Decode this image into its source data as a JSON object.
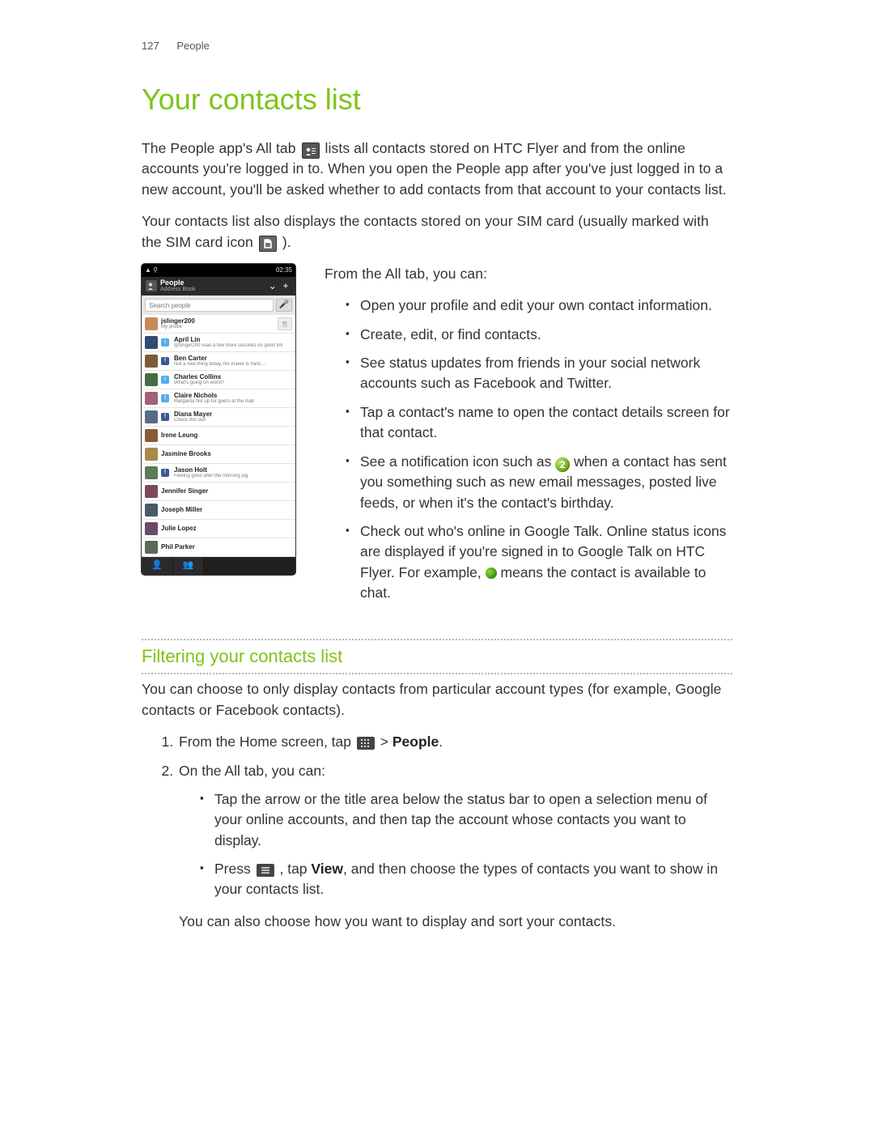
{
  "header": {
    "page_number": "127",
    "section": "People"
  },
  "title": "Your contacts list",
  "intro": {
    "p1a": "The People app's All tab ",
    "p1b": " lists all contacts stored on HTC Flyer and from the online accounts you're logged in to. When you open the People app after you've just logged in to a new account, you'll be asked whether to add contacts from that account to your contacts list.",
    "p2a": "Your contacts list also displays the contacts stored on your SIM card (usually marked with the SIM card icon ",
    "p2b": ")."
  },
  "phone": {
    "status_left": "▲ ⚲",
    "status_right": "02:35",
    "title": "People",
    "subtitle": "Address Book",
    "search_placeholder": "Search people",
    "contacts": [
      {
        "name": "jslinger200",
        "sub": "My profile",
        "color": "#c98b55",
        "right_btn": true
      },
      {
        "name": "April Lin",
        "sub": "@singer200 read a few more seconds on good tim",
        "color": "#324b72",
        "net": "tw"
      },
      {
        "name": "Ben Carter",
        "sub": "Not a new thing today, his maker is hard....",
        "color": "#7a5c3a",
        "net": "fb"
      },
      {
        "name": "Charles Collins",
        "sub": "What's going on world?",
        "color": "#4a6a45",
        "net": "tw"
      },
      {
        "name": "Claire Nichols",
        "sub": "Margarita fills up for goers at the mall",
        "color": "#a16278",
        "net": "tw"
      },
      {
        "name": "Diana Mayer",
        "sub": "Check this out!",
        "color": "#576b84",
        "net": "fb"
      },
      {
        "name": "Irene Leung",
        "sub": "",
        "color": "#8a5a3d"
      },
      {
        "name": "Jasmine Brooks",
        "sub": "",
        "color": "#a58a4a"
      },
      {
        "name": "Jason Holt",
        "sub": "Feeling good after the morning jog",
        "color": "#5c7a5c",
        "net": "fb"
      },
      {
        "name": "Jennifer Singer",
        "sub": "",
        "color": "#7a4a5a"
      },
      {
        "name": "Joseph Miller",
        "sub": "",
        "color": "#4a5a6a"
      },
      {
        "name": "Julie Lopez",
        "sub": "",
        "color": "#6a4a6a"
      },
      {
        "name": "Phil Parker",
        "sub": "",
        "color": "#5a6a5a"
      }
    ]
  },
  "all_tab": {
    "lead": "From the All tab, you can:",
    "items": [
      "Open your profile and edit your own contact information.",
      "Create, edit, or find contacts.",
      "See status updates from friends in your social network accounts such as Facebook and Twitter.",
      "Tap a contact's name to open the contact details screen for that contact."
    ],
    "notif_a": "See a notification icon such as ",
    "notif_b": " when a contact has sent you something such as new email messages, posted live feeds, or when it's the contact's birthday.",
    "gtalk_a": "Check out who's online in Google Talk. Online status icons are displayed if you're signed in to Google Talk on HTC Flyer. For example, ",
    "gtalk_b": " means the contact is available to chat.",
    "badge_value": "2"
  },
  "filter": {
    "heading": "Filtering your contacts list",
    "intro": "You can choose to only display contacts from particular account types (for example, Google contacts or Facebook contacts).",
    "step1a": "From the Home screen, tap ",
    "step1b": " > ",
    "step1c": "People",
    "step1d": ".",
    "step2_lead": "On the All tab, you can:",
    "sub1": "Tap the arrow or the title area below the status bar to open a selection menu of your online accounts, and then tap the account whose contacts you want to display.",
    "sub2a": "Press ",
    "sub2b": " , tap ",
    "sub2c": "View",
    "sub2d": ", and then choose the types of contacts you want to show in your contacts list.",
    "note": "You can also choose how you want to display and sort your contacts."
  }
}
